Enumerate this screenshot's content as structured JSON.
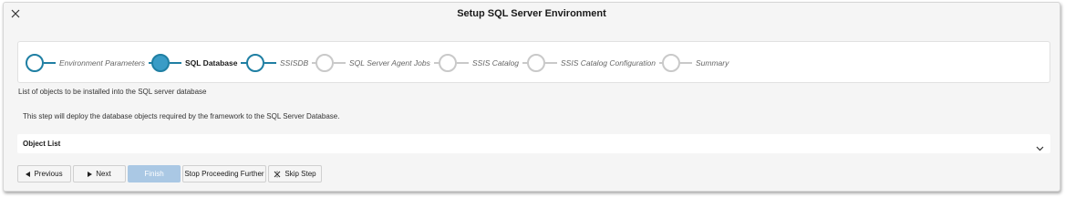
{
  "dialog": {
    "title": "Setup SQL Server Environment",
    "close_icon": "close-icon"
  },
  "stepper": {
    "steps": [
      {
        "label": "Environment Parameters",
        "state": "done"
      },
      {
        "label": "SQL Database",
        "state": "active"
      },
      {
        "label": "SSISDB",
        "state": "done"
      },
      {
        "label": "SQL Server Agent Jobs",
        "state": "pending"
      },
      {
        "label": "SSIS Catalog",
        "state": "pending"
      },
      {
        "label": "SSIS Catalog Configuration",
        "state": "pending"
      },
      {
        "label": "Summary",
        "state": "pending"
      }
    ],
    "colors": {
      "accent": "#1f7fa3",
      "active_fill": "#3a9cc6",
      "pending": "#c9c9c9"
    }
  },
  "content": {
    "subtitle": "List of objects to be installed into the SQL server database",
    "description": "This step will deploy the database objects required by the framework to the SQL Server Database.",
    "object_list_label": "Object List"
  },
  "buttons": {
    "previous": "Previous",
    "next": "Next",
    "finish": "Finish",
    "stop": "Stop Proceeding Further",
    "skip": "Skip Step"
  }
}
